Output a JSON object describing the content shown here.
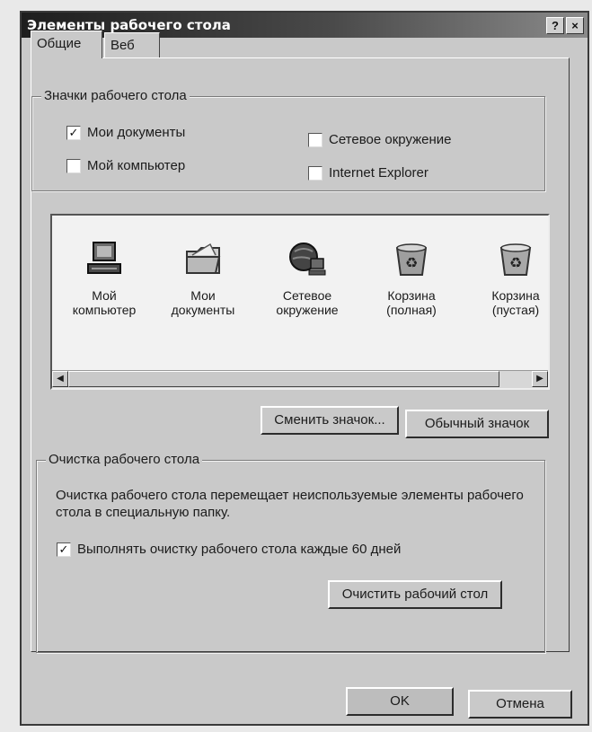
{
  "window": {
    "title": "Элементы рабочего стола",
    "help_glyph": "?",
    "close_glyph": "×"
  },
  "tabs": [
    {
      "label": "Общие",
      "selected": true
    },
    {
      "label": "Веб",
      "selected": false
    }
  ],
  "desktop_icons_group": {
    "label": "Значки рабочего стола",
    "checkboxes": [
      {
        "label": "Мои документы",
        "checked": true
      },
      {
        "label": "Сетевое окружение",
        "checked": false
      },
      {
        "label": "Мой компьютер",
        "checked": false
      },
      {
        "label": "Internet Explorer",
        "checked": false
      }
    ]
  },
  "icon_list": {
    "items": [
      {
        "line1": "Мой",
        "line2": "компьютер",
        "icon": "computer-icon"
      },
      {
        "line1": "Мои",
        "line2": "документы",
        "icon": "folder-icon"
      },
      {
        "line1": "Сетевое",
        "line2": "окружение",
        "icon": "network-icon"
      },
      {
        "line1": "Корзина",
        "line2": "(полная)",
        "icon": "recycle-bin-full-icon"
      },
      {
        "line1": "Корзина",
        "line2": "(пустая)",
        "icon": "recycle-bin-empty-icon"
      }
    ]
  },
  "buttons": {
    "change_icon": "Сменить значок...",
    "default_icon": "Обычный значок",
    "clean_desktop": "Очистить рабочий стол",
    "ok": "OK",
    "cancel": "Отмена"
  },
  "cleanup_group": {
    "label": "Очистка рабочего стола",
    "description": "Очистка рабочего стола перемещает неиспользуемые элементы рабочего стола в специальную папку.",
    "checkbox_label": "Выполнять очистку рабочего стола каждые 60 дней",
    "checked": true
  },
  "colors": {
    "dialog_face": "#c9c9c9",
    "title_bar": "#1e1e1e"
  }
}
